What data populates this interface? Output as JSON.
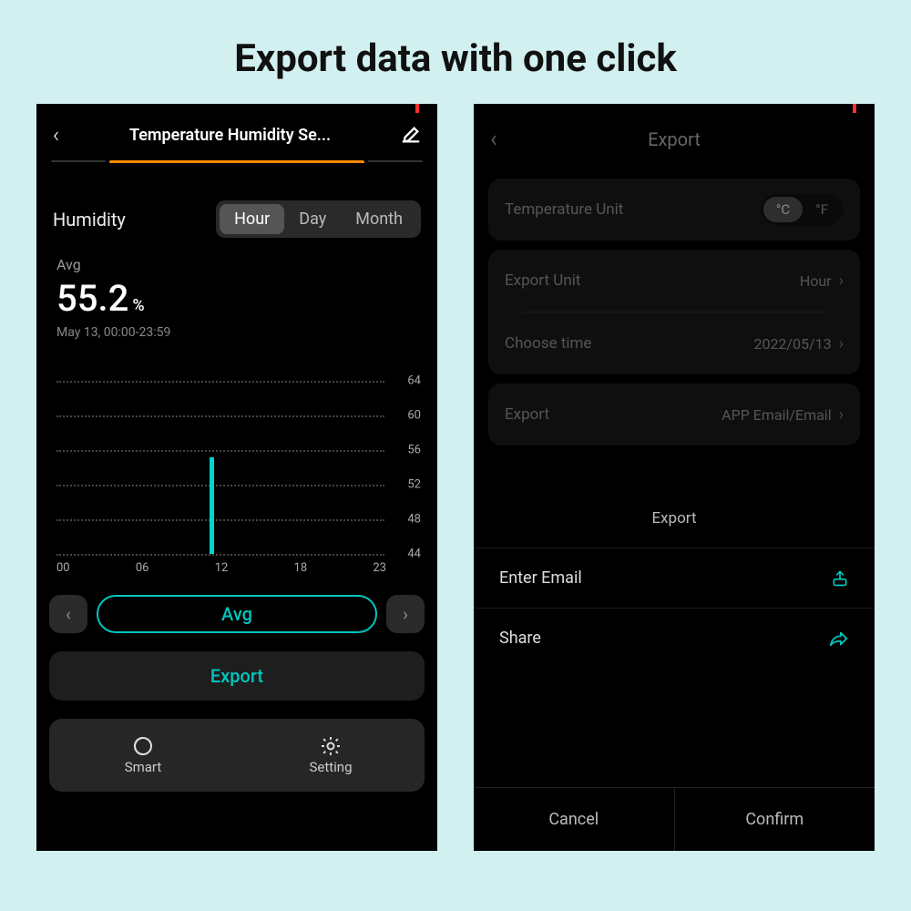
{
  "headline": "Export data with one click",
  "phone1": {
    "header_title": "Temperature Humidity Se...",
    "section_label": "Humidity",
    "segments": {
      "hour": "Hour",
      "day": "Day",
      "month": "Month",
      "active": "hour"
    },
    "stat": {
      "avg_label": "Avg",
      "avg_value": "55.2",
      "avg_unit": "%",
      "range": "May 13, 00:00-23:59"
    },
    "avg_button": "Avg",
    "export_button": "Export",
    "bottom_tabs": {
      "smart": "Smart",
      "setting": "Setting"
    }
  },
  "chart_data": {
    "type": "bar",
    "title": "Humidity",
    "xlabel": "",
    "ylabel": "",
    "ylim": [
      44,
      64
    ],
    "y_ticks": [
      64,
      60,
      56,
      52,
      48,
      44
    ],
    "categories": [
      "00",
      "06",
      "12",
      "18",
      "23"
    ],
    "series": [
      {
        "name": "Humidity %",
        "x": "10",
        "values": [
          55.2
        ]
      }
    ],
    "note": "Only one visible bar around hour 10, reaching ~55.2%."
  },
  "phone2": {
    "header_title": "Export",
    "rows": {
      "temp_unit_label": "Temperature Unit",
      "units": {
        "c": "°C",
        "f": "°F",
        "active": "c"
      },
      "export_unit_label": "Export Unit",
      "export_unit_value": "Hour",
      "choose_time_label": "Choose time",
      "choose_time_value": "2022/05/13",
      "export_label": "Export",
      "export_value": "APP Email/Email"
    },
    "sheet": {
      "title": "Export",
      "enter_email": "Enter Email",
      "share": "Share"
    },
    "actions": {
      "cancel": "Cancel",
      "confirm": "Confirm"
    }
  }
}
